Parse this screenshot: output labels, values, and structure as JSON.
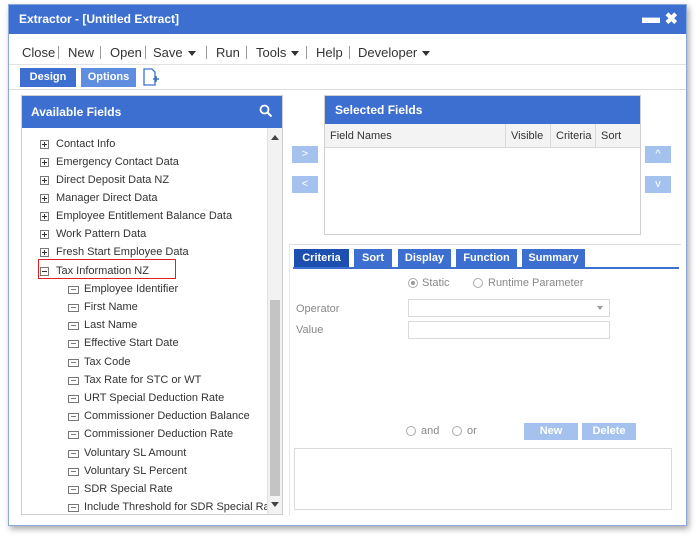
{
  "window": {
    "title": "Extractor - [Untitled Extract]",
    "minimize_glyph": "▬",
    "close_glyph": "✖"
  },
  "menu": {
    "close": "Close",
    "new": "New",
    "open": "Open",
    "save": "Save",
    "run": "Run",
    "tools": "Tools",
    "help": "Help",
    "developer": "Developer"
  },
  "toolbar": {
    "design": "Design",
    "options": "Options",
    "add_icon": "add-document-icon"
  },
  "available_fields": {
    "title": "Available Fields",
    "search_icon": "search-icon",
    "groups": [
      "Contact Info",
      "Emergency Contact Data",
      "Direct Deposit Data NZ",
      "Manager Direct Data",
      "Employee Entitlement Balance Data",
      "Work Pattern Data",
      "Fresh Start Employee Data"
    ],
    "expanded_group": "Tax Information NZ",
    "fields": [
      "Employee Identifier",
      "First Name",
      "Last Name",
      "Effective Start Date",
      "Tax Code",
      "Tax Rate for STC or WT",
      "URT Special Deduction Rate",
      "Commissioner Deduction Balance",
      "Commissioner Deduction Rate",
      "Voluntary SL Amount",
      "Voluntary SL Percent",
      "SDR Special Rate",
      "Include Threshold for SDR Special Rate"
    ]
  },
  "move_buttons": {
    "add": ">",
    "remove": "<",
    "up": "^",
    "down": "v"
  },
  "selected_fields": {
    "title": "Selected Fields",
    "columns": [
      "Field Names",
      "Visible",
      "Criteria",
      "Sort"
    ]
  },
  "criteria": {
    "tabs": [
      "Criteria",
      "Sort",
      "Display",
      "Function",
      "Summary"
    ],
    "static_label": "Static",
    "runtime_label": "Runtime Parameter",
    "operator_label": "Operator",
    "value_label": "Value",
    "and_label": "and",
    "or_label": "or",
    "new_button": "New",
    "delete_button": "Delete"
  }
}
